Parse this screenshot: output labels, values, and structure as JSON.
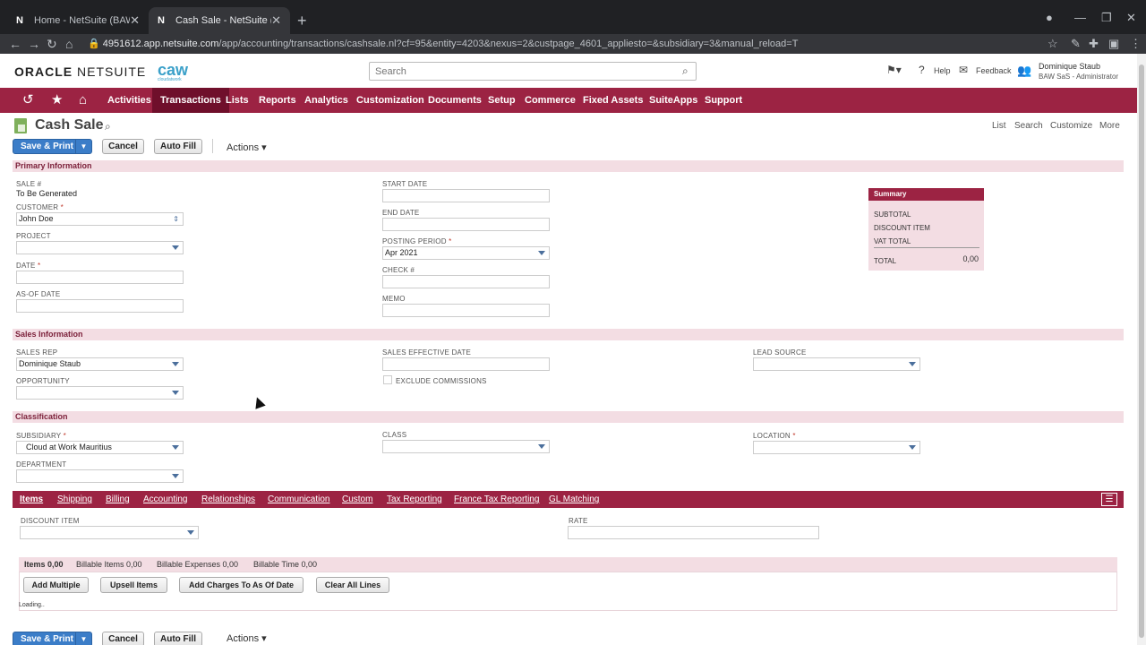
{
  "browser": {
    "tabs": [
      {
        "favicon": "N",
        "title": "Home - NetSuite (BAW SaS)"
      },
      {
        "favicon": "N",
        "title": "Cash Sale - NetSuite (BAW SaS)"
      }
    ],
    "url_host": "4951612.app.netsuite.com",
    "url_path": "/app/accounting/transactions/cashsale.nl?cf=95&entity=4203&nexus=2&custpage_4601_appliesto=&subsidiary=3&manual_reload=T"
  },
  "header": {
    "logo_oracle": "ORACLE",
    "logo_netsuite": "NETSUITE",
    "caw": "caw",
    "caw_sub": "cloudatwork",
    "search_placeholder": "Search",
    "help": "Help",
    "feedback": "Feedback",
    "user_name": "Dominique Staub",
    "user_role": "BAW SaS - Administrator"
  },
  "menu": [
    "Activities",
    "Transactions",
    "Lists",
    "Reports",
    "Analytics",
    "Customization",
    "Documents",
    "Setup",
    "Commerce",
    "Fixed Assets",
    "SuiteApps",
    "Support"
  ],
  "page": {
    "title": "Cash Sale",
    "links": [
      "List",
      "Search",
      "Customize",
      "More"
    ],
    "buttons": {
      "save_print": "Save & Print",
      "cancel": "Cancel",
      "auto_fill": "Auto Fill",
      "actions": "Actions ▾"
    }
  },
  "primary": {
    "section": "Primary Information",
    "sale_label": "SALE #",
    "sale_value": "To Be Generated",
    "customer_label": "CUSTOMER",
    "customer_value": "John Doe",
    "project_label": "PROJECT",
    "date_label": "DATE",
    "asof_label": "AS-OF DATE",
    "start_label": "START DATE",
    "end_label": "END DATE",
    "posting_label": "POSTING PERIOD",
    "posting_value": "Apr 2021",
    "check_label": "CHECK #",
    "memo_label": "MEMO"
  },
  "summary": {
    "title": "Summary",
    "subtotal": "SUBTOTAL",
    "discount": "DISCOUNT ITEM",
    "vat": "VAT TOTAL",
    "total": "TOTAL",
    "total_value": "0,00"
  },
  "sales": {
    "section": "Sales Information",
    "rep_label": "SALES REP",
    "rep_value": "Dominique Staub",
    "opportunity_label": "OPPORTUNITY",
    "effective_label": "SALES EFFECTIVE DATE",
    "exclude_label": "EXCLUDE COMMISSIONS",
    "lead_label": "LEAD SOURCE"
  },
  "classification": {
    "section": "Classification",
    "subsidiary_label": "SUBSIDIARY",
    "subsidiary_value": "Cloud at Work Mauritius",
    "department_label": "DEPARTMENT",
    "class_label": "CLASS",
    "location_label": "LOCATION"
  },
  "subtabs": [
    "Items",
    "Shipping",
    "Billing",
    "Accounting",
    "Relationships",
    "Communication",
    "Custom",
    "Tax Reporting",
    "France Tax Reporting",
    "GL Matching"
  ],
  "items": {
    "discount_label": "DISCOUNT ITEM",
    "rate_label": "RATE",
    "items_tab": "Items 0,00",
    "billable_items": "Billable Items 0,00",
    "billable_expenses": "Billable Expenses 0,00",
    "billable_time": "Billable Time 0,00",
    "add_multiple": "Add Multiple",
    "upsell": "Upsell Items",
    "add_charges": "Add Charges To As Of Date",
    "clear_lines": "Clear All Lines",
    "loading": "Loading.."
  },
  "colors": {
    "brand": "#9c2343",
    "brand_dark": "#6f0f2b",
    "section_bg": "#f3dde3",
    "primary_button": "#3b7dc8"
  }
}
